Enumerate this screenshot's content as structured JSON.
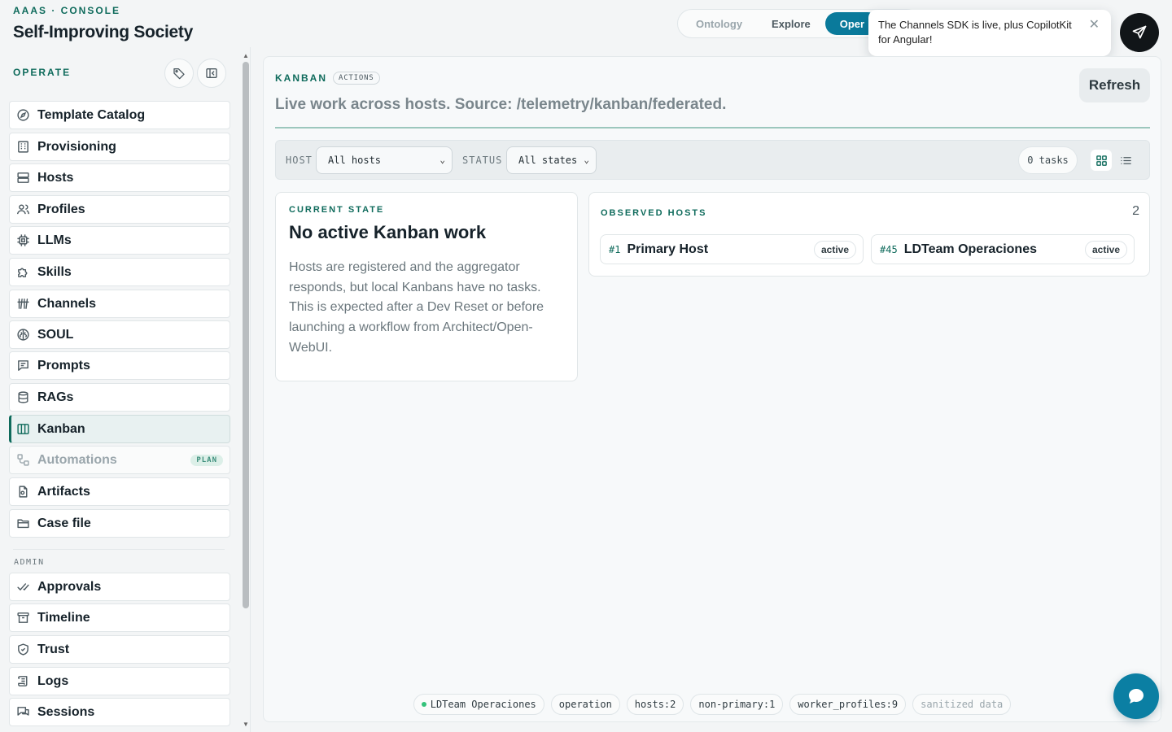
{
  "header": {
    "kicker": "AAAS · CONSOLE",
    "title": "Self-Improving Society",
    "modes": [
      {
        "label": "Ontology",
        "state": "inactive"
      },
      {
        "label": "Explore",
        "state": "inactive"
      },
      {
        "label": "Oper",
        "state": "active"
      }
    ]
  },
  "toast": {
    "message": "The Channels SDK is live, plus CopilotKit for Angular!",
    "close_icon": "close-icon"
  },
  "sidebar": {
    "section_operate": "OPERATE",
    "section_admin": "ADMIN",
    "operate_items": [
      {
        "label": "Template Catalog",
        "icon": "compass-icon"
      },
      {
        "label": "Provisioning",
        "icon": "building-icon"
      },
      {
        "label": "Hosts",
        "icon": "server-icon"
      },
      {
        "label": "Profiles",
        "icon": "users-icon"
      },
      {
        "label": "LLMs",
        "icon": "chip-icon"
      },
      {
        "label": "Skills",
        "icon": "puzzle-icon"
      },
      {
        "label": "Channels",
        "icon": "channels-icon"
      },
      {
        "label": "SOUL",
        "icon": "brain-icon"
      },
      {
        "label": "Prompts",
        "icon": "message-icon"
      },
      {
        "label": "RAGs",
        "icon": "database-icon"
      },
      {
        "label": "Kanban",
        "icon": "columns-icon",
        "active": true
      },
      {
        "label": "Automations",
        "icon": "workflow-icon",
        "badge": "PLAN",
        "muted": true
      },
      {
        "label": "Artifacts",
        "icon": "file-icon"
      },
      {
        "label": "Case file",
        "icon": "folder-icon"
      }
    ],
    "admin_items": [
      {
        "label": "Approvals",
        "icon": "check-icon"
      },
      {
        "label": "Timeline",
        "icon": "archive-icon"
      },
      {
        "label": "Trust",
        "icon": "shield-icon"
      },
      {
        "label": "Logs",
        "icon": "scroll-icon"
      },
      {
        "label": "Sessions",
        "icon": "chat-icon"
      }
    ]
  },
  "main": {
    "kicker": "KANBAN",
    "badge": "ACTIONS",
    "subtitle": "Live work across hosts. Source: /telemetry/kanban/federated.",
    "refresh_label": "Refresh",
    "filters": {
      "host_label": "HOST",
      "host_value": "All hosts",
      "status_label": "STATUS",
      "status_value": "All states",
      "task_count": "0 tasks"
    },
    "state_card": {
      "kicker": "CURRENT STATE",
      "title": "No active Kanban work",
      "body": "Hosts are registered and the aggregator responds, but local Kanbans have no tasks. This is expected after a Dev Reset or before launching a workflow from Architect/Open-WebUI."
    },
    "hosts_card": {
      "kicker": "OBSERVED HOSTS",
      "count": "2",
      "hosts": [
        {
          "num": "#1",
          "name": "Primary Host",
          "status": "active"
        },
        {
          "num": "#45",
          "name": "LDTeam Operaciones",
          "status": "active"
        }
      ]
    },
    "footer_chips": [
      {
        "label": "LDTeam Operaciones",
        "dot": true
      },
      {
        "label": "operation"
      },
      {
        "label": "hosts:2"
      },
      {
        "label": "non-primary:1"
      },
      {
        "label": "worker_profiles:9"
      },
      {
        "label": "sanitized data",
        "faint": true
      }
    ]
  },
  "colors": {
    "accent": "#0f6b5c",
    "mode_active": "#0a7a9b",
    "chat_bubble": "#0b7fa3"
  }
}
